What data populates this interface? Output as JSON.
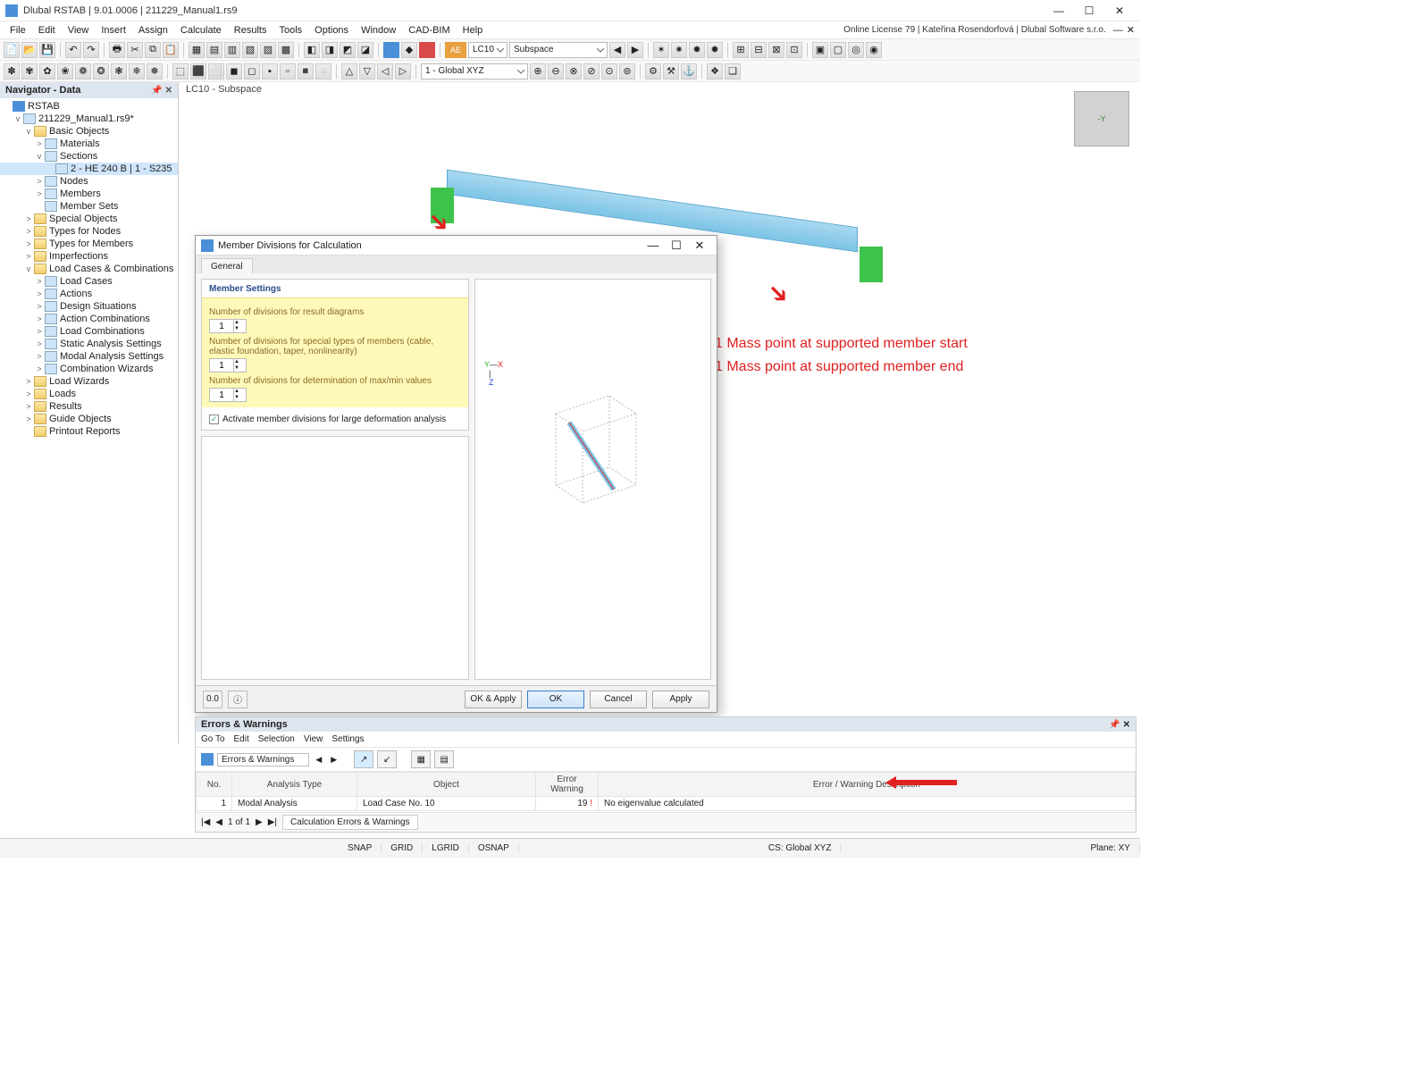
{
  "title": "Dlubal RSTAB | 9.01.0006 | 211229_Manual1.rs9",
  "license_text": "Online License 79 | Kateřina Rosendorfová | Dlubal Software s.r.o.",
  "menu": [
    "File",
    "Edit",
    "View",
    "Insert",
    "Assign",
    "Calculate",
    "Results",
    "Tools",
    "Options",
    "Window",
    "CAD-BIM",
    "Help"
  ],
  "toolbar1": {
    "ae_label": "AE",
    "lc_dropdown": "LC10",
    "method_dropdown": "Subspace"
  },
  "toolbar2": {
    "coord_dropdown": "1 - Global XYZ"
  },
  "navigator": {
    "title": "Navigator - Data",
    "root": "RSTAB",
    "file": "211229_Manual1.rs9*",
    "tree": [
      {
        "lvl": 2,
        "caret": "v",
        "icon": "folder",
        "label": "Basic Objects"
      },
      {
        "lvl": 3,
        "caret": ">",
        "icon": "itemi",
        "label": "Materials"
      },
      {
        "lvl": 3,
        "caret": "v",
        "icon": "itemi",
        "label": "Sections"
      },
      {
        "lvl": 4,
        "caret": "",
        "icon": "itemi",
        "label": "2 - HE 240 B | 1 - S235",
        "sel": true
      },
      {
        "lvl": 3,
        "caret": ">",
        "icon": "itemi",
        "label": "Nodes"
      },
      {
        "lvl": 3,
        "caret": ">",
        "icon": "itemi",
        "label": "Members"
      },
      {
        "lvl": 3,
        "caret": "",
        "icon": "itemi",
        "label": "Member Sets"
      },
      {
        "lvl": 2,
        "caret": ">",
        "icon": "folder",
        "label": "Special Objects"
      },
      {
        "lvl": 2,
        "caret": ">",
        "icon": "folder",
        "label": "Types for Nodes"
      },
      {
        "lvl": 2,
        "caret": ">",
        "icon": "folder",
        "label": "Types for Members"
      },
      {
        "lvl": 2,
        "caret": ">",
        "icon": "folder",
        "label": "Imperfections"
      },
      {
        "lvl": 2,
        "caret": "v",
        "icon": "folder",
        "label": "Load Cases & Combinations"
      },
      {
        "lvl": 3,
        "caret": ">",
        "icon": "itemi",
        "label": "Load Cases"
      },
      {
        "lvl": 3,
        "caret": ">",
        "icon": "itemi",
        "label": "Actions"
      },
      {
        "lvl": 3,
        "caret": ">",
        "icon": "itemi",
        "label": "Design Situations"
      },
      {
        "lvl": 3,
        "caret": ">",
        "icon": "itemi",
        "label": "Action Combinations"
      },
      {
        "lvl": 3,
        "caret": ">",
        "icon": "itemi",
        "label": "Load Combinations"
      },
      {
        "lvl": 3,
        "caret": ">",
        "icon": "itemi",
        "label": "Static Analysis Settings"
      },
      {
        "lvl": 3,
        "caret": ">",
        "icon": "itemi",
        "label": "Modal Analysis Settings"
      },
      {
        "lvl": 3,
        "caret": ">",
        "icon": "itemi",
        "label": "Combination Wizards"
      },
      {
        "lvl": 2,
        "caret": ">",
        "icon": "folder",
        "label": "Load Wizards"
      },
      {
        "lvl": 2,
        "caret": ">",
        "icon": "folder",
        "label": "Loads"
      },
      {
        "lvl": 2,
        "caret": ">",
        "icon": "folder",
        "label": "Results"
      },
      {
        "lvl": 2,
        "caret": ">",
        "icon": "folder",
        "label": "Guide Objects"
      },
      {
        "lvl": 2,
        "caret": "",
        "icon": "folder",
        "label": "Printout Reports"
      }
    ]
  },
  "viewport": {
    "title": "LC10 - Subspace",
    "cube_label": "-Y",
    "annotation1": "1 Mass point at supported member start",
    "annotation2": "1 Mass point at supported member end"
  },
  "dialog": {
    "title": "Member Divisions for Calculation",
    "tab": "General",
    "section_header": "Member Settings",
    "sub1": "Number of divisions for result diagrams",
    "val1": "1",
    "sub2": "Number of divisions for special types of members (cable, elastic foundation, taper, nonlinearity)",
    "val2": "1",
    "sub3": "Number of divisions for determination of max/min values",
    "val3": "1",
    "checkbox": "Activate member divisions for large deformation analysis",
    "btn_ok_apply": "OK & Apply",
    "btn_ok": "OK",
    "btn_cancel": "Cancel",
    "btn_apply": "Apply"
  },
  "errors": {
    "title": "Errors & Warnings",
    "menu": [
      "Go To",
      "Edit",
      "Selection",
      "View",
      "Settings"
    ],
    "dropdown": "Errors & Warnings",
    "columns": [
      "No.",
      "Analysis Type",
      "Object",
      "Error Warning",
      "Error / Warning Description"
    ],
    "row": {
      "no": "1",
      "type": "Modal Analysis",
      "object": "Load Case No. 10",
      "warn": "19",
      "desc": "No eigenvalue calculated"
    },
    "pager_text": "1 of 1",
    "pager_tab": "Calculation Errors & Warnings"
  },
  "statusbar": {
    "snap": "SNAP",
    "grid": "GRID",
    "lgrid": "LGRID",
    "osnap": "OSNAP",
    "cs": "CS: Global XYZ",
    "plane": "Plane: XY"
  }
}
